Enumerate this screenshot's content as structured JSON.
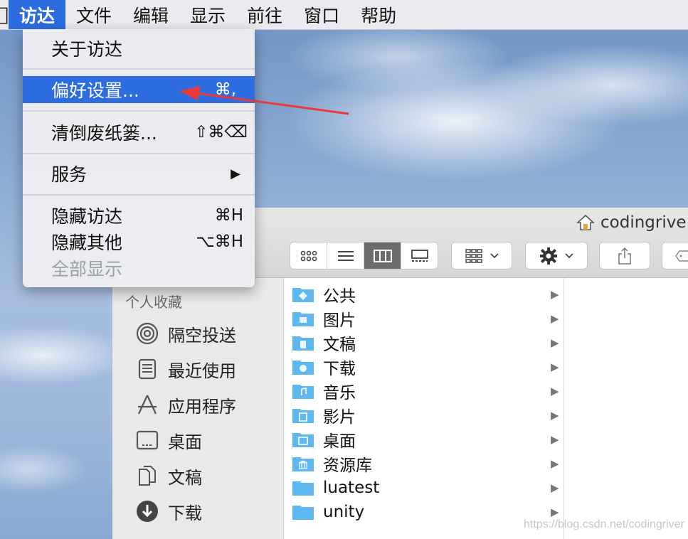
{
  "menubar": {
    "items": [
      "访达",
      "文件",
      "编辑",
      "显示",
      "前往",
      "窗口",
      "帮助"
    ]
  },
  "dropdown": {
    "about": "关于访达",
    "preferences": "偏好设置...",
    "preferences_shortcut": "⌘,",
    "empty_trash": "清倒废纸篓...",
    "empty_trash_shortcut": "⇧⌘⌫",
    "services": "服务",
    "services_arrow": "▶",
    "hide_finder": "隐藏访达",
    "hide_finder_shortcut": "⌘H",
    "hide_others": "隐藏其他",
    "hide_others_shortcut": "⌥⌘H",
    "show_all": "全部显示"
  },
  "finder": {
    "title": "codingrive",
    "sidebar": {
      "heading": "个人收藏",
      "items": [
        "隔空投送",
        "最近使用",
        "应用程序",
        "桌面",
        "文稿",
        "下载"
      ]
    },
    "files": [
      "公共",
      "图片",
      "文稿",
      "下载",
      "音乐",
      "影片",
      "桌面",
      "资源库",
      "luatest",
      "unity"
    ]
  },
  "colors": {
    "accent": "#2d6de0",
    "folder": "#5cb8ef",
    "arrow": "#e83a3a"
  },
  "watermark": "https://blog.csdn.net/codingriver"
}
